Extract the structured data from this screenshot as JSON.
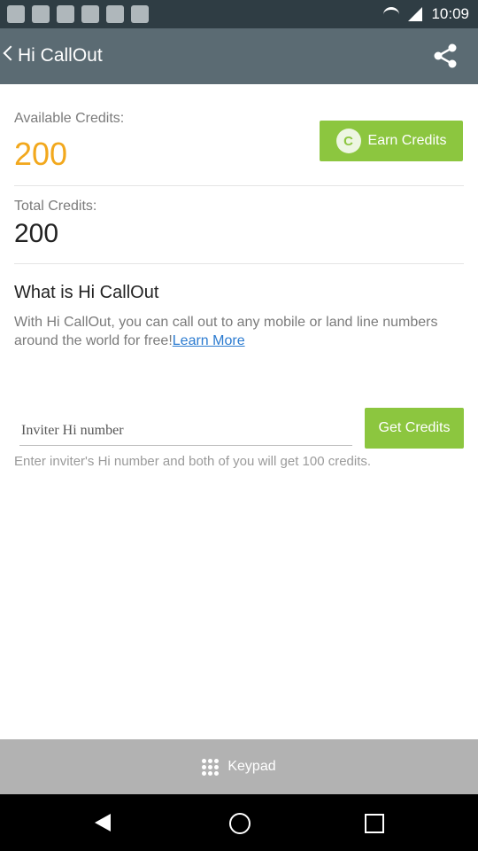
{
  "status": {
    "time": "10:09"
  },
  "header": {
    "title": "Hi CallOut"
  },
  "credits": {
    "available_label": "Available Credits:",
    "available_value": "200",
    "earn_button": "Earn Credits",
    "total_label": "Total Credits:",
    "total_value": "200"
  },
  "about": {
    "title": "What is Hi CallOut",
    "description": "With Hi CallOut, you can call out to any mobile or land line numbers around the world for free!",
    "learn_more": "Learn More"
  },
  "invite": {
    "placeholder": "Inviter Hi number",
    "button": "Get Credits",
    "hint": "Enter inviter's Hi number and both of you will get 100 credits."
  },
  "footer": {
    "keypad_label": "Keypad"
  },
  "colors": {
    "accent": "#8cc63f",
    "appbar": "#5b6b73",
    "available": "#f2a81d",
    "link": "#2b7bd0"
  },
  "icons": [
    "back-icon",
    "share-icon",
    "coin-icon",
    "keypad-icon"
  ]
}
